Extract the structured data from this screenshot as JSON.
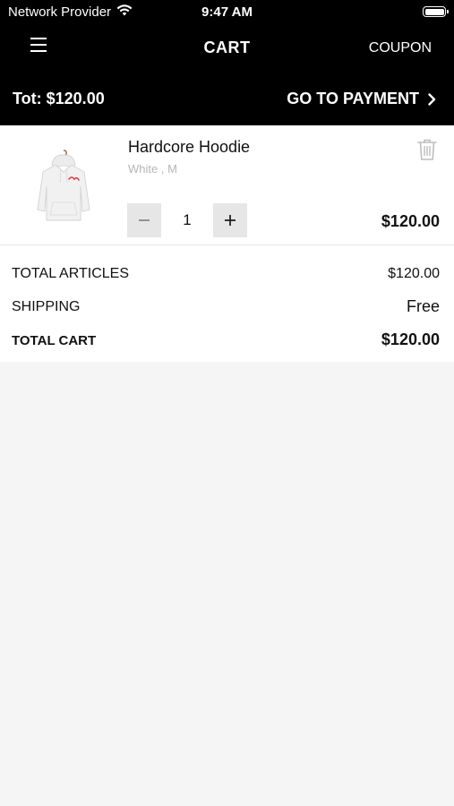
{
  "status_bar": {
    "carrier": "Network Provider",
    "time": "9:47 AM"
  },
  "nav": {
    "title": "CART",
    "coupon_label": "COUPON"
  },
  "header_total": {
    "label": "Tot: $120.00",
    "pay_label": "GO TO PAYMENT"
  },
  "cart": {
    "items": [
      {
        "name": "Hardcore Hoodie",
        "variant": "White , M",
        "quantity": "1",
        "price": "$120.00",
        "icon": "hoodie-image"
      }
    ]
  },
  "summary": {
    "articles_label": "TOTAL ARTICLES",
    "articles_value": "$120.00",
    "shipping_label": "SHIPPING",
    "shipping_value": "Free",
    "total_label": "TOTAL CART",
    "total_value": "$120.00"
  },
  "colors": {
    "header_bg": "#000000",
    "page_bg": "#f5f5f5",
    "card_bg": "#ffffff",
    "stepper_bg": "#e6e6e6",
    "variant_text": "#b5b5b5"
  }
}
